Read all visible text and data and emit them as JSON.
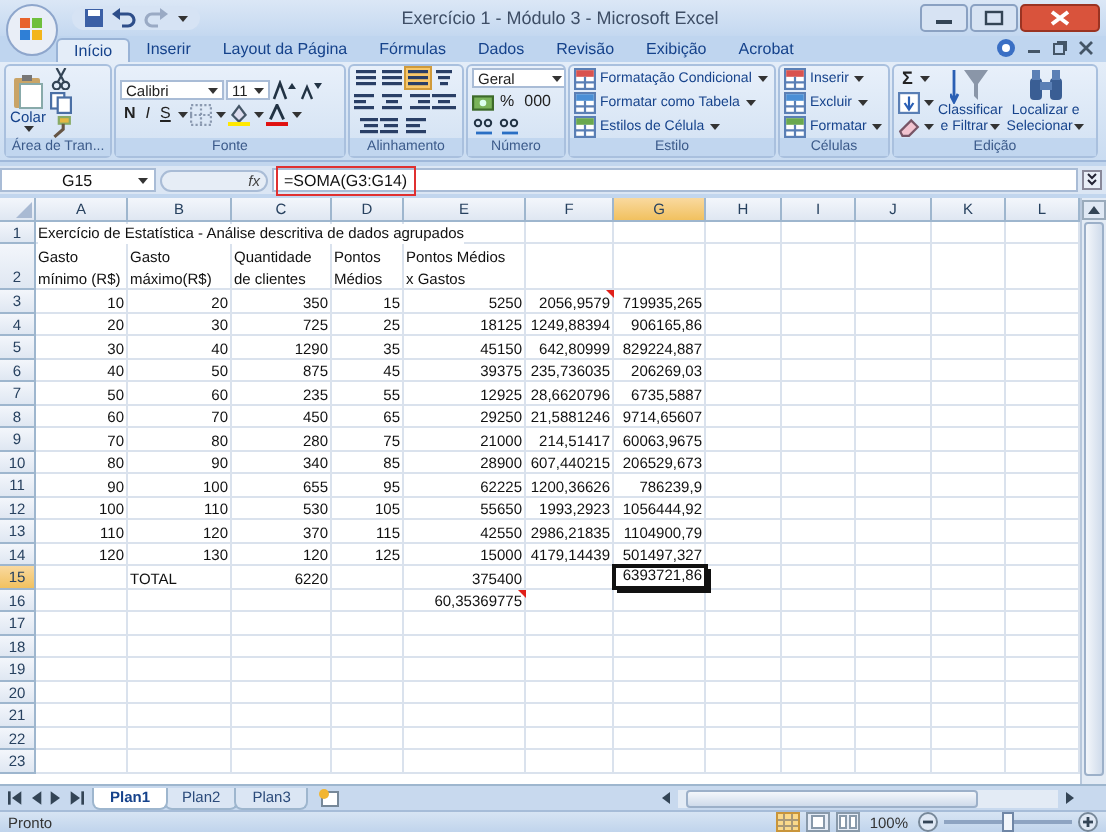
{
  "window": {
    "title": "Exercício 1 - Módulo 3 - Microsoft Excel"
  },
  "tabs": [
    {
      "label": "Início",
      "selected": true
    },
    {
      "label": "Inserir",
      "selected": false
    },
    {
      "label": "Layout da Página",
      "selected": false
    },
    {
      "label": "Fórmulas",
      "selected": false
    },
    {
      "label": "Dados",
      "selected": false
    },
    {
      "label": "Revisão",
      "selected": false
    },
    {
      "label": "Exibição",
      "selected": false
    },
    {
      "label": "Acrobat",
      "selected": false
    }
  ],
  "ribbon": {
    "groups": [
      {
        "kind": "clipboard",
        "label": "Área de Tran...",
        "paste": "Colar"
      },
      {
        "kind": "font",
        "label": "Fonte",
        "font": "Calibri",
        "size": "11",
        "bold": "N",
        "italic": "I",
        "underline": "S"
      },
      {
        "kind": "alignment",
        "label": "Alinhamento",
        "bottom_align_on": true
      },
      {
        "kind": "number",
        "label": "Número",
        "format": "Geral",
        "percent": "%",
        "thousands": "000"
      },
      {
        "kind": "styles",
        "label": "Estilo",
        "commands": [
          "Formatação Condicional",
          "Formatar como Tabela",
          "Estilos de Célula"
        ]
      },
      {
        "kind": "cells",
        "label": "Células",
        "commands": [
          "Inserir",
          "Excluir",
          "Formatar"
        ]
      },
      {
        "kind": "editing",
        "label": "Edição",
        "sum": "Σ",
        "sort": "Classificar\ne Filtrar",
        "find": "Localizar e\nSelecionar"
      }
    ]
  },
  "formula_bar": {
    "name_box": "G15",
    "fx": "fx",
    "formula": "=SOMA(G3:G14)",
    "highlighted": true
  },
  "sheet": {
    "columns": [
      {
        "label": "A",
        "selected": false
      },
      {
        "label": "B",
        "selected": false
      },
      {
        "label": "C",
        "selected": false
      },
      {
        "label": "D",
        "selected": false
      },
      {
        "label": "E",
        "selected": false
      },
      {
        "label": "F",
        "selected": false
      },
      {
        "label": "G",
        "selected": true
      },
      {
        "label": "H",
        "selected": false
      },
      {
        "label": "I",
        "selected": false
      },
      {
        "label": "J",
        "selected": false
      },
      {
        "label": "K",
        "selected": false
      },
      {
        "label": "L",
        "selected": false
      }
    ],
    "rows": [
      {
        "number": "1",
        "kind": "title",
        "selected": false,
        "cells": [
          {
            "text": "Exercício de Estatística - Análise descritiva de dados agrupados",
            "comment": false
          }
        ]
      },
      {
        "number": "2",
        "kind": "header",
        "selected": false,
        "cells": [
          {
            "text": "Gasto\nmínimo (R$)",
            "comment": false
          },
          {
            "text": "Gasto\nmáximo(R$)",
            "comment": false
          },
          {
            "text": "Quantidade\nde clientes",
            "comment": false
          },
          {
            "text": "Pontos\nMédios",
            "comment": false
          },
          {
            "text": "Pontos Médios\nx Gastos",
            "comment": false
          }
        ]
      },
      {
        "number": "3",
        "kind": "data",
        "selected": false,
        "cells": [
          {
            "text": "10",
            "comment": false
          },
          {
            "text": "20",
            "comment": false
          },
          {
            "text": "350",
            "comment": false
          },
          {
            "text": "15",
            "comment": false
          },
          {
            "text": "5250",
            "comment": false
          },
          {
            "text": "2056,9579",
            "comment": true
          },
          {
            "text": "719935,265",
            "comment": false
          }
        ]
      },
      {
        "number": "4",
        "kind": "data",
        "selected": false,
        "cells": [
          {
            "text": "20",
            "comment": false
          },
          {
            "text": "30",
            "comment": false
          },
          {
            "text": "725",
            "comment": false
          },
          {
            "text": "25",
            "comment": false
          },
          {
            "text": "18125",
            "comment": false
          },
          {
            "text": "1249,88394",
            "comment": false
          },
          {
            "text": "906165,86",
            "comment": false
          }
        ]
      },
      {
        "number": "5",
        "kind": "data",
        "selected": false,
        "cells": [
          {
            "text": "30",
            "comment": false
          },
          {
            "text": "40",
            "comment": false
          },
          {
            "text": "1290",
            "comment": false
          },
          {
            "text": "35",
            "comment": false
          },
          {
            "text": "45150",
            "comment": false
          },
          {
            "text": "642,80999",
            "comment": false
          },
          {
            "text": "829224,887",
            "comment": false
          }
        ]
      },
      {
        "number": "6",
        "kind": "data",
        "selected": false,
        "cells": [
          {
            "text": "40",
            "comment": false
          },
          {
            "text": "50",
            "comment": false
          },
          {
            "text": "875",
            "comment": false
          },
          {
            "text": "45",
            "comment": false
          },
          {
            "text": "39375",
            "comment": false
          },
          {
            "text": "235,736035",
            "comment": false
          },
          {
            "text": "206269,03",
            "comment": false
          }
        ]
      },
      {
        "number": "7",
        "kind": "data",
        "selected": false,
        "cells": [
          {
            "text": "50",
            "comment": false
          },
          {
            "text": "60",
            "comment": false
          },
          {
            "text": "235",
            "comment": false
          },
          {
            "text": "55",
            "comment": false
          },
          {
            "text": "12925",
            "comment": false
          },
          {
            "text": "28,6620796",
            "comment": false
          },
          {
            "text": "6735,5887",
            "comment": false
          }
        ]
      },
      {
        "number": "8",
        "kind": "data",
        "selected": false,
        "cells": [
          {
            "text": "60",
            "comment": false
          },
          {
            "text": "70",
            "comment": false
          },
          {
            "text": "450",
            "comment": false
          },
          {
            "text": "65",
            "comment": false
          },
          {
            "text": "29250",
            "comment": false
          },
          {
            "text": "21,5881246",
            "comment": false
          },
          {
            "text": "9714,65607",
            "comment": false
          }
        ]
      },
      {
        "number": "9",
        "kind": "data",
        "selected": false,
        "cells": [
          {
            "text": "70",
            "comment": false
          },
          {
            "text": "80",
            "comment": false
          },
          {
            "text": "280",
            "comment": false
          },
          {
            "text": "75",
            "comment": false
          },
          {
            "text": "21000",
            "comment": false
          },
          {
            "text": "214,51417",
            "comment": false
          },
          {
            "text": "60063,9675",
            "comment": false
          }
        ]
      },
      {
        "number": "10",
        "kind": "data",
        "selected": false,
        "cells": [
          {
            "text": "80",
            "comment": false
          },
          {
            "text": "90",
            "comment": false
          },
          {
            "text": "340",
            "comment": false
          },
          {
            "text": "85",
            "comment": false
          },
          {
            "text": "28900",
            "comment": false
          },
          {
            "text": "607,440215",
            "comment": false
          },
          {
            "text": "206529,673",
            "comment": false
          }
        ]
      },
      {
        "number": "11",
        "kind": "data",
        "selected": false,
        "cells": [
          {
            "text": "90",
            "comment": false
          },
          {
            "text": "100",
            "comment": false
          },
          {
            "text": "655",
            "comment": false
          },
          {
            "text": "95",
            "comment": false
          },
          {
            "text": "62225",
            "comment": false
          },
          {
            "text": "1200,36626",
            "comment": false
          },
          {
            "text": "786239,9",
            "comment": false
          }
        ]
      },
      {
        "number": "12",
        "kind": "data",
        "selected": false,
        "cells": [
          {
            "text": "100",
            "comment": false
          },
          {
            "text": "110",
            "comment": false
          },
          {
            "text": "530",
            "comment": false
          },
          {
            "text": "105",
            "comment": false
          },
          {
            "text": "55650",
            "comment": false
          },
          {
            "text": "1993,2923",
            "comment": false
          },
          {
            "text": "1056444,92",
            "comment": false
          }
        ]
      },
      {
        "number": "13",
        "kind": "data",
        "selected": false,
        "cells": [
          {
            "text": "110",
            "comment": false
          },
          {
            "text": "120",
            "comment": false
          },
          {
            "text": "370",
            "comment": false
          },
          {
            "text": "115",
            "comment": false
          },
          {
            "text": "42550",
            "comment": false
          },
          {
            "text": "2986,21835",
            "comment": false
          },
          {
            "text": "1104900,79",
            "comment": false
          }
        ]
      },
      {
        "number": "14",
        "kind": "data",
        "selected": false,
        "cells": [
          {
            "text": "120",
            "comment": false
          },
          {
            "text": "130",
            "comment": false
          },
          {
            "text": "120",
            "comment": false
          },
          {
            "text": "125",
            "comment": false
          },
          {
            "text": "15000",
            "comment": false
          },
          {
            "text": "4179,14439",
            "comment": false
          },
          {
            "text": "501497,327",
            "comment": false
          }
        ]
      },
      {
        "number": "15",
        "kind": "total",
        "selected": true,
        "cells": [
          null,
          {
            "text": "TOTAL",
            "comment": false
          },
          {
            "text": "6220",
            "comment": false
          },
          null,
          {
            "text": "375400",
            "comment": false
          },
          null,
          {
            "text": "6393721,86",
            "comment": false
          }
        ]
      },
      {
        "number": "16",
        "kind": "data",
        "selected": false,
        "cells": [
          null,
          null,
          null,
          null,
          {
            "text": "60,35369775",
            "comment": true
          }
        ]
      },
      {
        "number": "17",
        "kind": "data",
        "selected": false,
        "cells": []
      },
      {
        "number": "18",
        "kind": "data",
        "selected": false,
        "cells": []
      },
      {
        "number": "19",
        "kind": "data",
        "selected": false,
        "cells": []
      },
      {
        "number": "20",
        "kind": "data",
        "selected": false,
        "cells": []
      },
      {
        "number": "21",
        "kind": "data",
        "selected": false,
        "cells": []
      },
      {
        "number": "22",
        "kind": "data",
        "selected": false,
        "cells": []
      },
      {
        "number": "23",
        "kind": "data",
        "selected": false,
        "cells": []
      }
    ]
  },
  "sheet_tabs": [
    {
      "label": "Plan1",
      "selected": true
    },
    {
      "label": "Plan2",
      "selected": false
    },
    {
      "label": "Plan3",
      "selected": false
    }
  ],
  "status_bar": {
    "status": "Pronto",
    "zoom": "100%",
    "zoom_slider": {
      "level": 0.5
    }
  }
}
